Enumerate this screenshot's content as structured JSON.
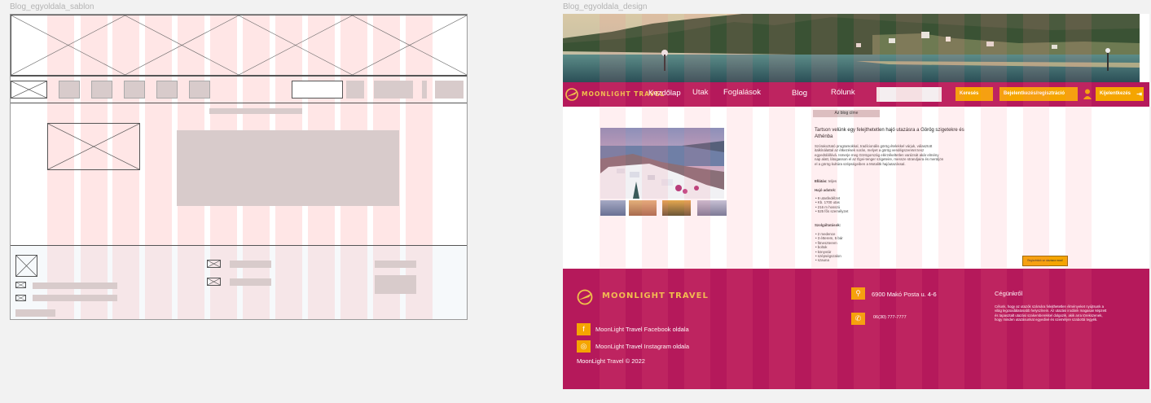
{
  "labels": {
    "template": "Blog_egyoldala_sablon",
    "design": "Blog_egyoldala_design"
  },
  "nav": {
    "brand": "MOONLIGHT TRAVEL",
    "links": [
      "Kezdőlap",
      "Utak",
      "Foglalások",
      "Blog",
      "Rólunk"
    ],
    "search_button": "Keresés",
    "auth_button": "Bejelentkezés/regisztráció",
    "logout_button": "Kijelentkezés"
  },
  "blog": {
    "title_badge": "Az blog címe",
    "heading": "Tartson velünk egy felejthetetlen hajó utazásra a Görög szigetekre és Athénba",
    "intro": "Szórakoztató programokkal, tradícionális görög ételekkel várjuk, választott italkínálattal az étkezések során, melyet a görög vendégszeretet tesz egyedülállóvá. Ismerje meg Görögország elérzékeltetlen varázsát akár elmény nap alatt, látogasson el az Égei-tenger szigeteire, messze strandjaira és merüljön el a görög kultúra szépségeiben a Motalitk hajóutazással.",
    "board_label": "Ellátás:",
    "board_value": "teljes",
    "ship_heading": "Hajó adatok:",
    "ship_items": [
      "9 utasfedélzet",
      "Kb. 1700 utas",
      "216 m hosszú",
      "525 fős személyzet"
    ],
    "services_heading": "Szolgáltatások:",
    "services_items": [
      "2 medence",
      "3 étterem, 5 bár",
      "fitneszterem",
      "boltok",
      "könyvtár",
      "szépségszalon",
      "szauna"
    ],
    "cta": "Regisztrálok az utazásra most!"
  },
  "footer": {
    "brand": "MOONLIGHT TRAVEL",
    "address": "6900 Makó Posta u. 4-6",
    "phone": "06(30) 777-7777",
    "facebook": "MoonLight Travel Facebook oldala",
    "instagram": "MoonLight Travel Instagram oldala",
    "copyright": "MoonLight Travel © 2022",
    "about_title": "Cégünkről",
    "about_text": "Célunk, hogy az utazók számára felejthetetlen élményeket nyújtsunk a világ legcsodálatosabb helyszínein. Az utazási irodánk magasan képzett és tapasztalt utazási szakemberekkel dolgozik, akik arra törekszenek, hogy minden utazásunkat egyedivé és személyre szabottá tegyék."
  },
  "colors": {
    "brand_magenta": "#b5195b",
    "accent_orange": "#f5a500",
    "brand_gold": "#f0c24a"
  },
  "icons": {
    "logo": "airplane-globe-logo",
    "user": "user-icon",
    "logout": "logout-icon",
    "location": "location-pin-icon",
    "phone": "phone-icon",
    "facebook": "facebook-icon",
    "instagram": "instagram-icon"
  }
}
